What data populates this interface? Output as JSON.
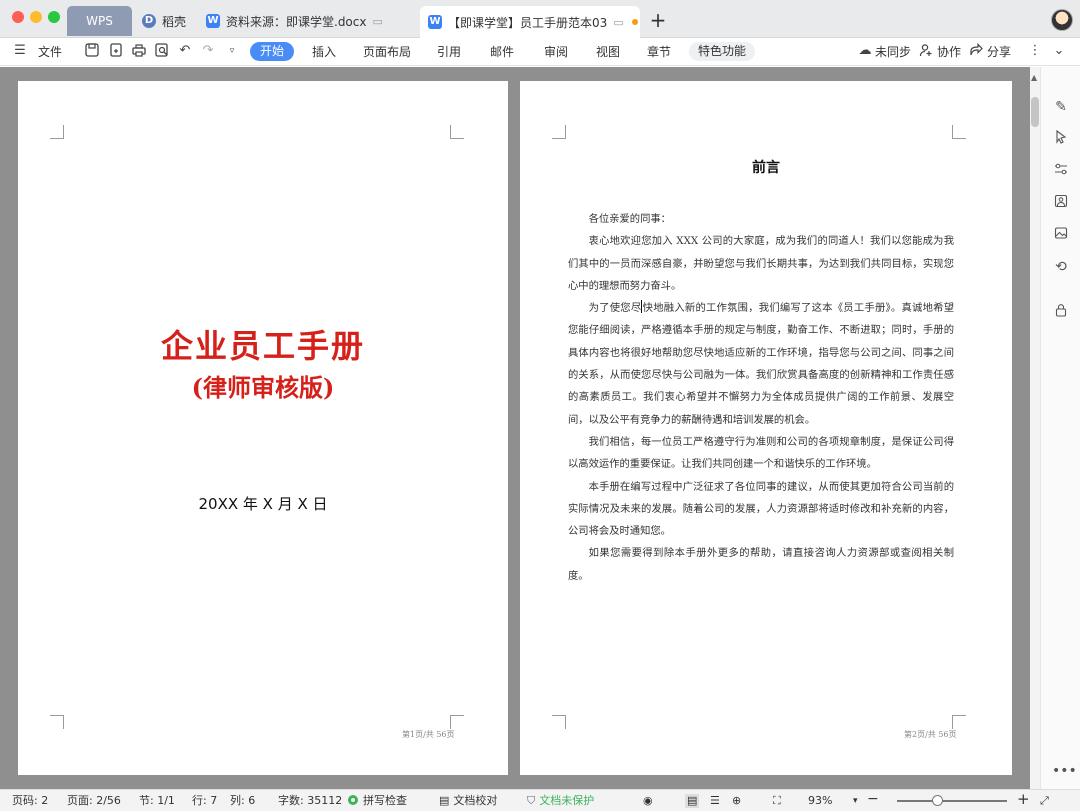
{
  "titlebar": {
    "tabs": [
      {
        "label": "WPS"
      },
      {
        "label": "稻壳"
      },
      {
        "label": "资料来源：即课学堂.docx"
      },
      {
        "label": "【即课学堂】员工手册范本03"
      }
    ],
    "new_tab": "+"
  },
  "toolbar": {
    "file": "文件",
    "menu": [
      "开始",
      "插入",
      "页面布局",
      "引用",
      "邮件",
      "审阅",
      "视图",
      "章节",
      "特色功能"
    ],
    "sync": "未同步",
    "collab": "协作",
    "share": "分享"
  },
  "cover": {
    "title": "企业员工手册",
    "subtitle": "(律师审核版)",
    "date": "20XX 年 X 月 X 日",
    "footer": "第1页/共 56页"
  },
  "preface": {
    "title": "前言",
    "greeting": "各位亲爱的同事：",
    "paragraphs": [
      "衷心地欢迎您加入 XXX 公司的大家庭，成为我们的同道人！我们以您能成为我们其中的一员而深感自豪，并盼望您与我们长期共事，为达到我们共同目标，实现您心中的理想而努力奋斗。",
      "为了使您尽",
      "快地融入新的工作氛围，我们编写了这本《员工手册》。真诚地希望您能仔细阅读，严格遵循本手册的规定与制度，勤奋工作、不断进取；同时，手册的具体内容也将很好地帮助您尽快地适应新的工作环境，指导您与公司之间、同事之间的关系，从而使您尽快与公司融为一体。我们欣赏具备高度的创新精神和工作责任感的高素质员工。我们衷心希望并不懈努力为全体成员提供广阔的工作前景、发展空间，以及公平有竞争力的薪酬待遇和培训发展的机会。",
      "我们相信，每一位员工严格遵守行为准则和公司的各项规章制度，是保证公司得以高效运作的重要保证。让我们共同创建一个和谐快乐的工作环境。",
      "本手册在编写过程中广泛征求了各位同事的建议，从而使其更加符合公司当前的实际情况及未来的发展。随着公司的发展，人力资源部将适时修改和补充新的内容，公司将会及时通知您。",
      "如果您需要得到除本手册外更多的帮助，请直接咨询人力资源部或查阅相关制度。"
    ],
    "footer": "第2页/共 56页"
  },
  "statusbar": {
    "page_code": "页码: 2",
    "pages": "页面: 2/56",
    "section": "节: 1/1",
    "row": "行: 7",
    "col": "列: 6",
    "word_count": "字数: 35112",
    "spell_check": "拼写检查",
    "doc_proof": "文档校对",
    "doc_protect": "文档未保护",
    "zoom": "93%",
    "zoom_fraction": 0.37
  },
  "colors": {
    "accent": "#4a8cf5",
    "cover_red": "#d6201a",
    "protect_green": "#3cb25b"
  }
}
